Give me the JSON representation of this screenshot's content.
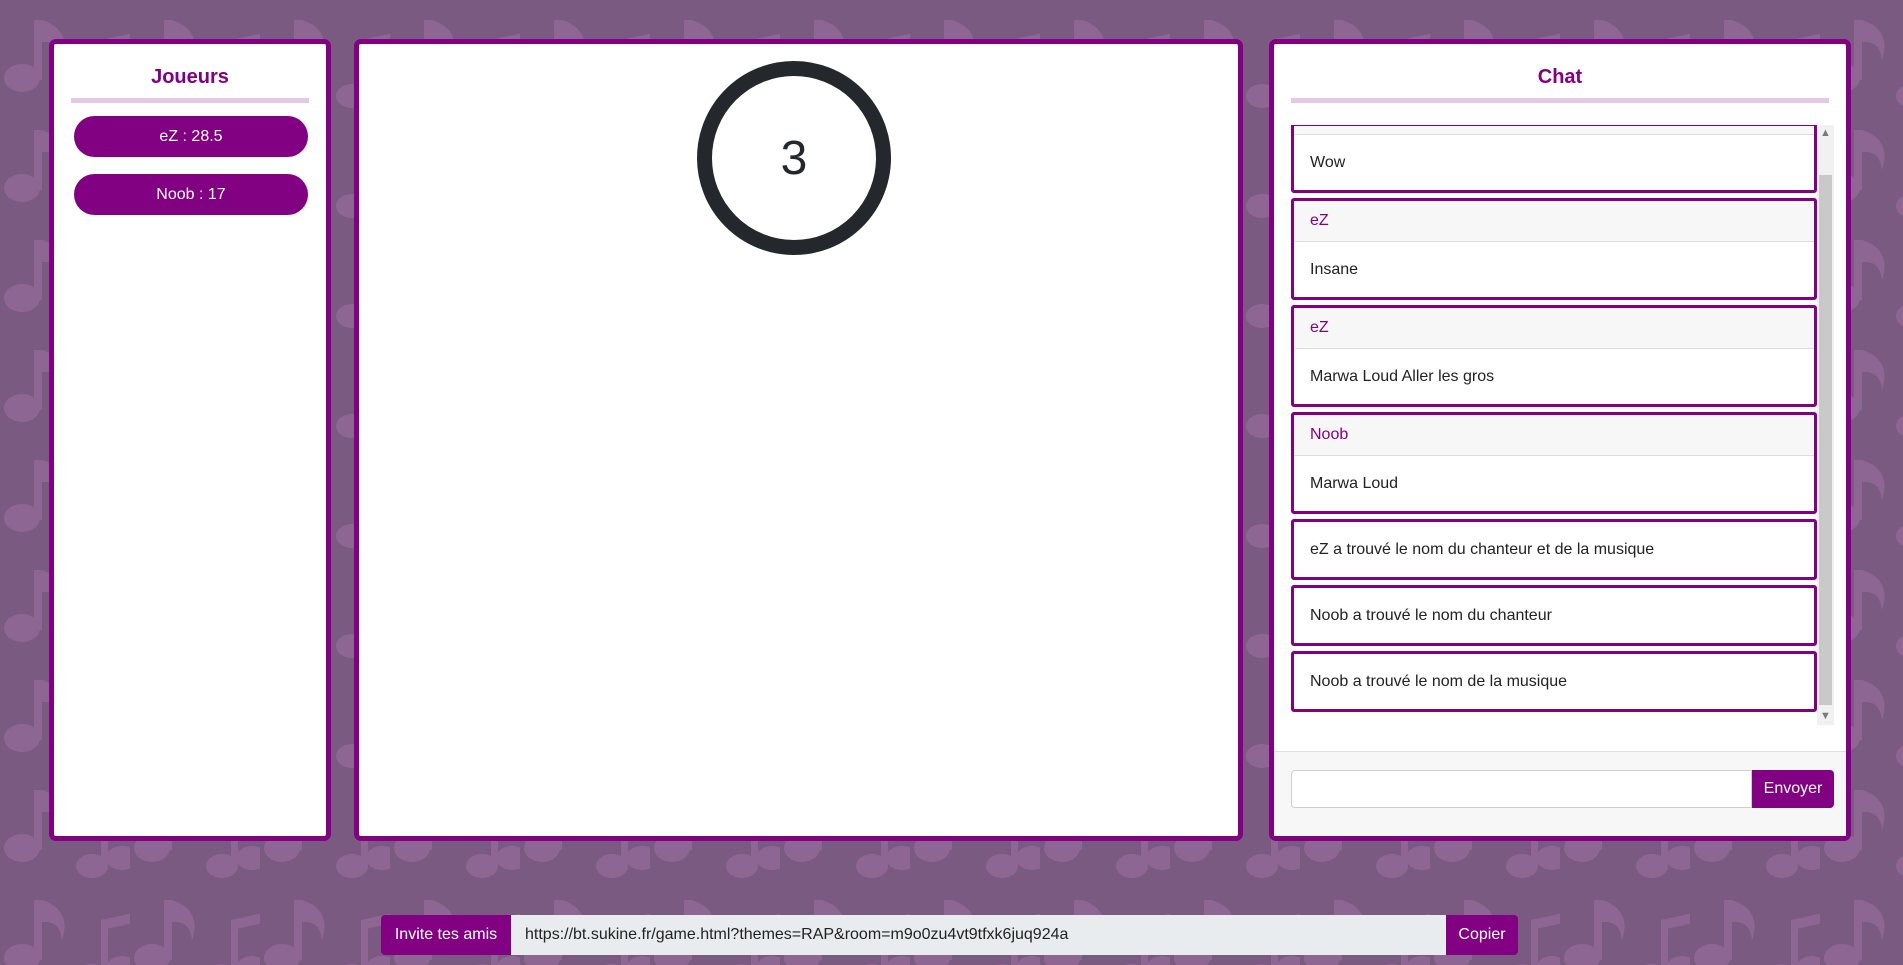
{
  "colors": {
    "accent": "#820182",
    "background": "#7a5a80",
    "pattern": "#8e6694",
    "countdown_ring": "#24272b"
  },
  "players_panel": {
    "title": "Joueurs",
    "players": [
      {
        "label": "eZ : 28.5"
      },
      {
        "label": "Noob : 17"
      }
    ]
  },
  "game": {
    "countdown": "3"
  },
  "chat": {
    "title": "Chat",
    "messages": [
      {
        "author": "",
        "text": "Wow"
      },
      {
        "author": "eZ",
        "text": "Insane"
      },
      {
        "author": "eZ",
        "text": "Marwa Loud Aller les gros"
      },
      {
        "author": "Noob",
        "text": "Marwa Loud"
      },
      {
        "author": "",
        "text": "eZ a trouvé le nom du chanteur et de la musique"
      },
      {
        "author": "",
        "text": "Noob a trouvé le nom du chanteur"
      },
      {
        "author": "",
        "text": "Noob a trouvé le nom de la musique"
      }
    ],
    "input_value": "",
    "send_label": "Envoyer"
  },
  "invite": {
    "label": "Invite tes amis !",
    "url": "https://bt.sukine.fr/game.html?themes=RAP&room=m9o0zu4vt9tfxk6juq924a",
    "copy_label": "Copier"
  },
  "icons": {
    "background": "music-note-icon",
    "scroll_up": "chevron-up-icon",
    "scroll_down": "chevron-down-icon"
  }
}
